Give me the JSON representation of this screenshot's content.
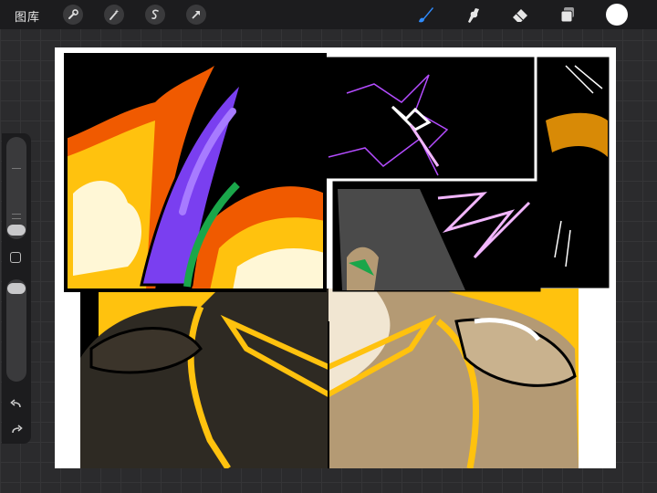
{
  "app": {
    "gallery_label": "图库"
  },
  "toolbar": {
    "left_tools": [
      "wrench-icon",
      "magic-wand-icon",
      "selection-icon",
      "transform-arrow-icon"
    ],
    "right_tools": [
      "brush-icon",
      "smudge-icon",
      "eraser-icon",
      "layers-icon"
    ],
    "active_tool": "brush",
    "active_color": "#ffffff",
    "accent_color": "#2f8cff"
  },
  "sidebar": {
    "brush_size_level": 0.7,
    "opacity_level": 0.95,
    "buttons": [
      "square-modifier-icon",
      "undo-icon",
      "redo-icon"
    ]
  },
  "canvas": {
    "background": "#ffffff",
    "panel_colors": [
      "#000000",
      "#7a3ff0",
      "#f05a00",
      "#ffc20e",
      "#b49a74",
      "#2e2a23"
    ]
  }
}
